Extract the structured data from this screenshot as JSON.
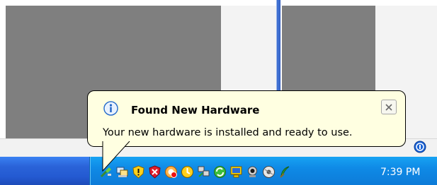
{
  "balloon": {
    "title": "Found New Hardware",
    "message": "Your new hardware is installed and ready to use.",
    "title_icon": "info-icon",
    "close_icon": "close-icon"
  },
  "taskbar": {
    "clock": "7:39 PM",
    "tray_icons": [
      "safely-remove-hardware-icon",
      "network-connection-icon",
      "security-center-shield-icon",
      "security-alert-shield-icon",
      "firewall-icon",
      "scheduler-icon",
      "network-adapter-icon",
      "sync-icon",
      "display-icon",
      "webcam-icon",
      "media-disc-icon",
      "feather-icon"
    ]
  },
  "colors": {
    "taskbar_blue": "#245ad2",
    "tray_blue": "#0f8ae6",
    "balloon_bg": "#ffffe1"
  }
}
